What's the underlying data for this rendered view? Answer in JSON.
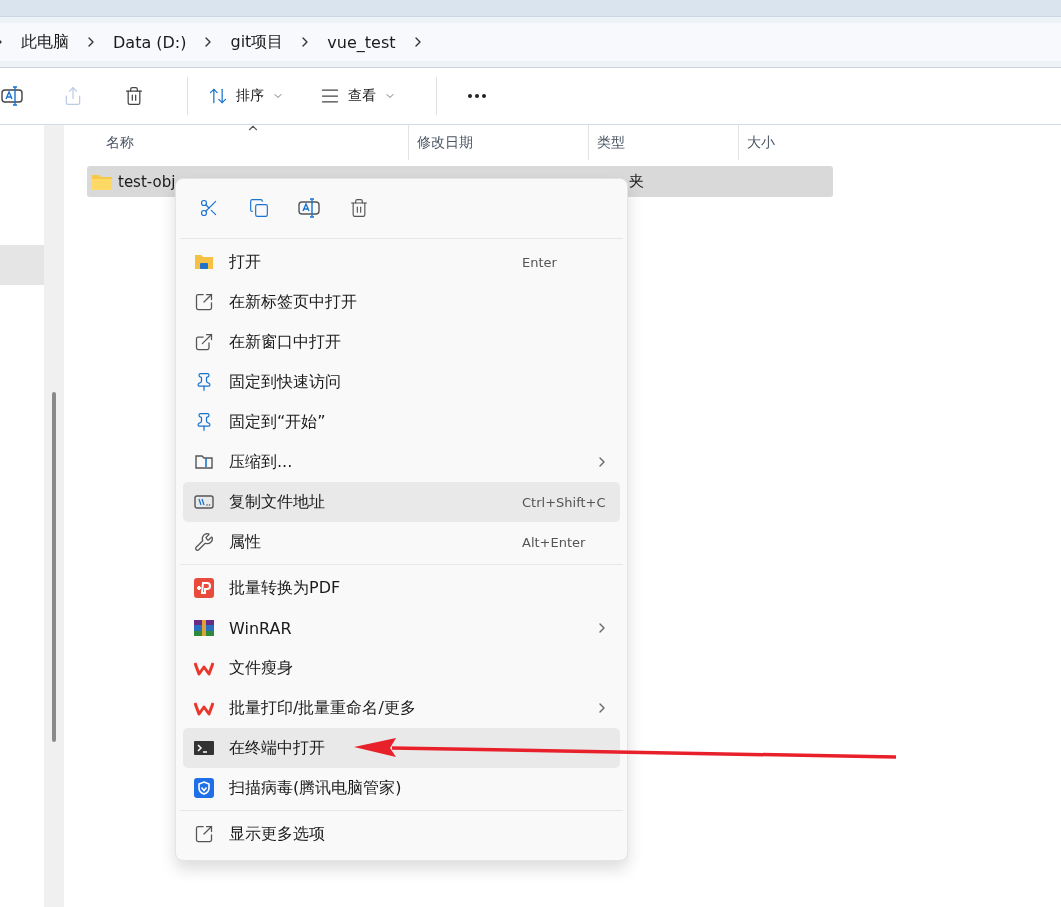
{
  "address_bar": {
    "breadcrumbs": [
      "此电脑",
      "Data (D:)",
      "git项目",
      "vue_test"
    ]
  },
  "toolbar": {
    "icon_buttons": [
      {
        "kind": "rename",
        "disabled": false
      },
      {
        "kind": "share",
        "disabled": true
      },
      {
        "kind": "delete",
        "disabled": false
      }
    ],
    "sort": {
      "label": "排序"
    },
    "view": {
      "label": "查看"
    }
  },
  "nav_pane": {
    "items": [
      {
        "selected": false
      },
      {
        "selected": false
      },
      {
        "selected": false
      },
      {
        "selected": true
      }
    ]
  },
  "file_list": {
    "columns": [
      "名称",
      "修改日期",
      "类型",
      "大小"
    ],
    "rows": [
      {
        "name": "test-obj",
        "type": "夹",
        "selected": true
      }
    ]
  },
  "context_menu": {
    "groups": [
      [
        {
          "label": "打开",
          "shortcut": "Enter",
          "submenu": false,
          "highlighted": false
        },
        {
          "label": "在新标签页中打开",
          "submenu": false,
          "highlighted": false
        },
        {
          "label": "在新窗口中打开",
          "submenu": false,
          "highlighted": false
        },
        {
          "label": "固定到快速访问",
          "submenu": false,
          "highlighted": false
        },
        {
          "label": "固定到“开始”",
          "submenu": false,
          "highlighted": false
        },
        {
          "label": "压缩到...",
          "submenu": true,
          "highlighted": false
        },
        {
          "label": "复制文件地址",
          "shortcut": "Ctrl+Shift+C",
          "submenu": false,
          "highlighted": true
        },
        {
          "label": "属性",
          "shortcut": "Alt+Enter",
          "submenu": false,
          "highlighted": false
        }
      ],
      [
        {
          "label": "批量转换为PDF",
          "submenu": false,
          "highlighted": false
        },
        {
          "label": "WinRAR",
          "submenu": true,
          "highlighted": false
        },
        {
          "label": "文件瘦身",
          "submenu": false,
          "highlighted": false
        },
        {
          "label": "批量打印/批量重命名/更多",
          "submenu": true,
          "highlighted": false
        },
        {
          "label": "在终端中打开",
          "submenu": false,
          "highlighted": true
        },
        {
          "label": "扫描病毒(腾讯电脑管家)",
          "submenu": false,
          "highlighted": false
        }
      ],
      [
        {
          "label": "显示更多选项",
          "submenu": false,
          "highlighted": false
        }
      ]
    ]
  }
}
